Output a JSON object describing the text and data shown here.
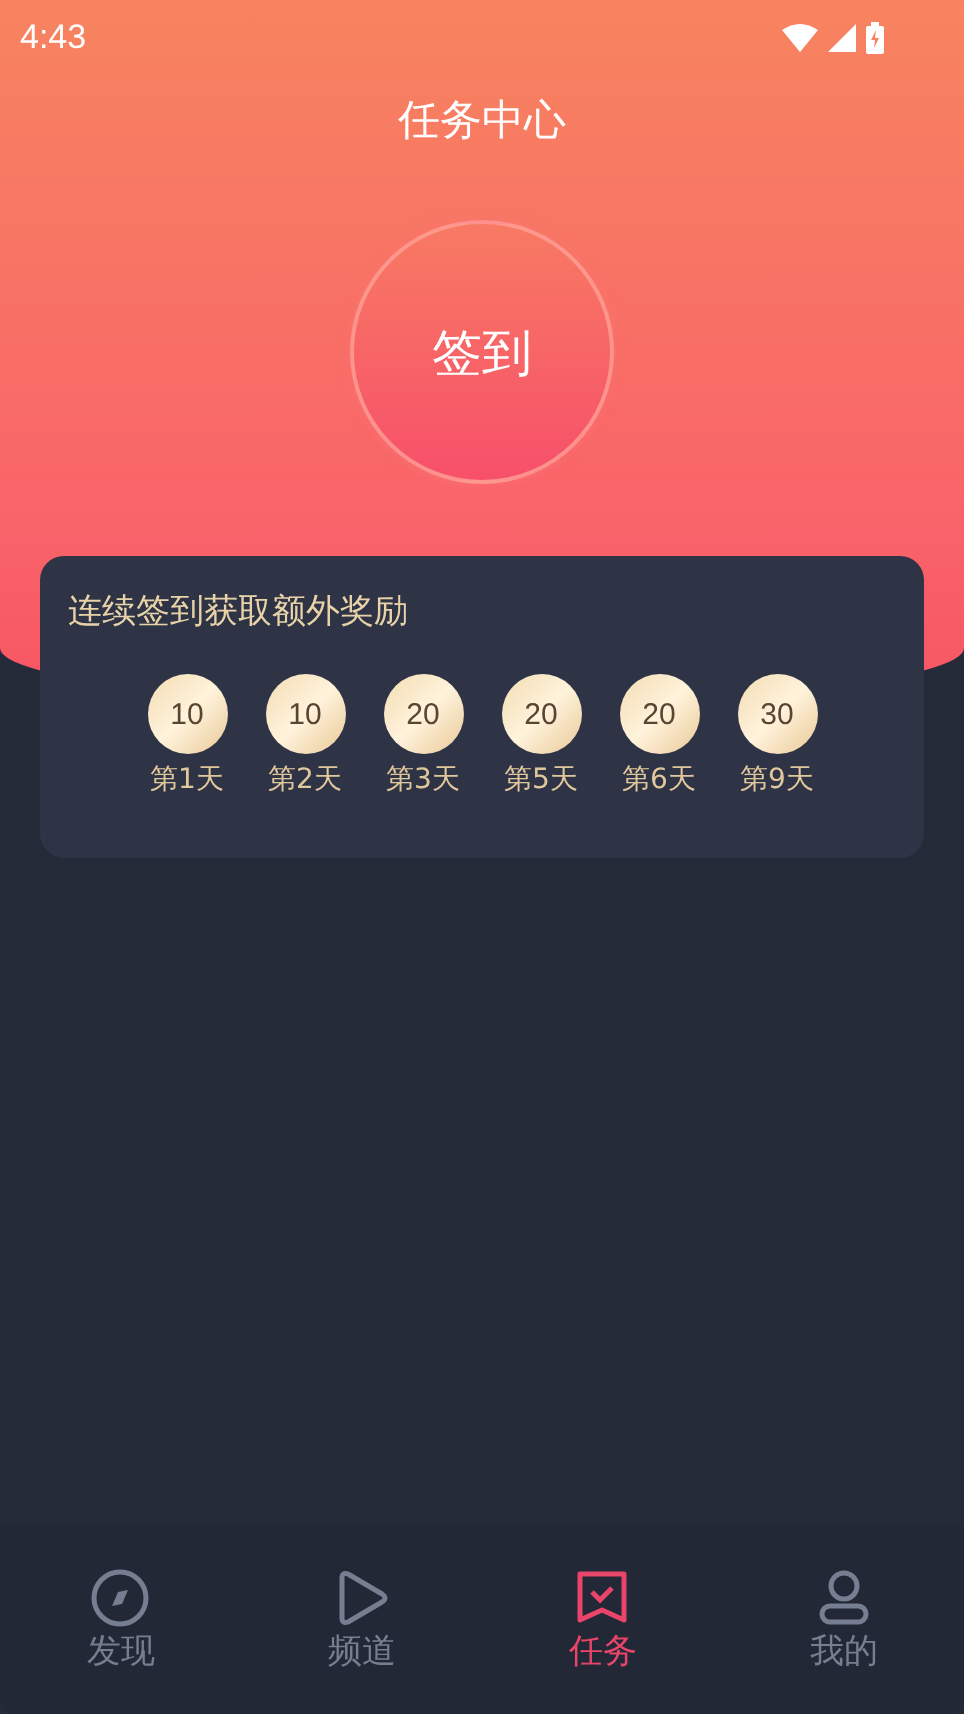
{
  "status_bar": {
    "time": "4:43"
  },
  "title": "任务中心",
  "checkin_button": "签到",
  "streak_card": {
    "title": "连续签到获取额外奖励",
    "rewards": [
      {
        "points": "10",
        "day": "第1天"
      },
      {
        "points": "10",
        "day": "第2天"
      },
      {
        "points": "20",
        "day": "第3天"
      },
      {
        "points": "20",
        "day": "第5天"
      },
      {
        "points": "20",
        "day": "第6天"
      },
      {
        "points": "30",
        "day": "第9天"
      }
    ]
  },
  "tab_bar": [
    {
      "label": "发现",
      "kind": "compass",
      "selected": false
    },
    {
      "label": "频道",
      "kind": "play",
      "selected": false
    },
    {
      "label": "任务",
      "kind": "task",
      "selected": true
    },
    {
      "label": "我的",
      "kind": "user",
      "selected": false
    }
  ]
}
